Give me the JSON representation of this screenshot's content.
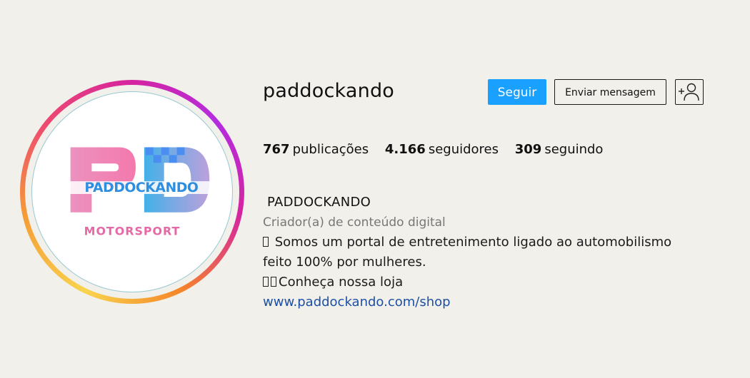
{
  "profile": {
    "username": "paddockando",
    "avatar": {
      "icon": "paddockando-motorsport-logo",
      "logo_text": "PADDOCKANDO",
      "logo_subtext": "MOTORSPORT",
      "colors": {
        "ring_start": "#f8d44d",
        "ring_end": "#b32ce0",
        "pink": "#f36aa3",
        "blue": "#2ea8e6",
        "lavender": "#b596d8",
        "checker": "#4a8ef2"
      }
    }
  },
  "actions": {
    "follow_label": "Seguir",
    "message_label": "Enviar mensagem",
    "add_user_icon": "add-user-icon"
  },
  "stats": {
    "posts": {
      "value": "767",
      "label": "publicações"
    },
    "followers": {
      "value": "4.166",
      "label": "seguidores"
    },
    "following": {
      "value": "309",
      "label": "seguindo"
    }
  },
  "bio": {
    "name": "PADDOCKANDO",
    "category": "Criador(a) de conteúdo digital",
    "line1": "Somos um portal de entretenimento ligado ao automobilismo",
    "line2": "feito 100% por mulheres.",
    "line3": "Conheça nossa loja",
    "link": "www.paddockando.com/shop"
  },
  "colors": {
    "background": "#f1f0eb",
    "follow_button": "#1aa0ff",
    "link": "#1e4fa3",
    "muted_text": "#777777"
  }
}
